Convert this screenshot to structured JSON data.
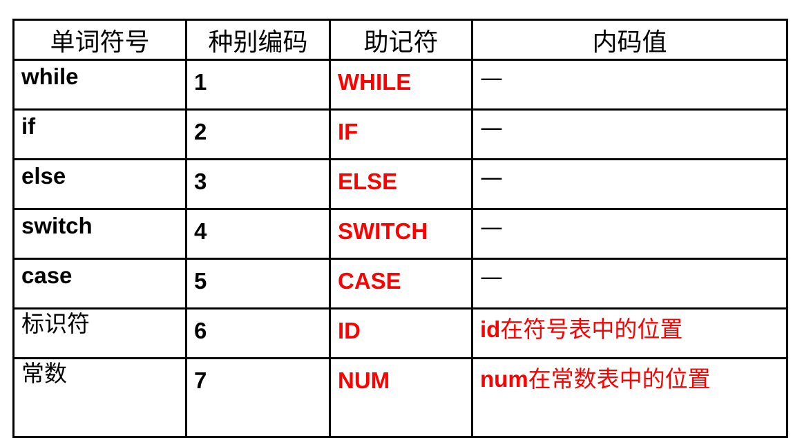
{
  "table": {
    "headers": [
      "单词符号",
      "种别编码",
      "助记符",
      "内码值"
    ],
    "rows": [
      {
        "word": "while",
        "code": "1",
        "mnemonic": "WHILE",
        "value": "—"
      },
      {
        "word": "if",
        "code": "2",
        "mnemonic": "IF",
        "value": "—"
      },
      {
        "word": "else",
        "code": "3",
        "mnemonic": "ELSE",
        "value": "—"
      },
      {
        "word": "switch",
        "code": "4",
        "mnemonic": "SWITCH",
        "value": "—"
      },
      {
        "word": "case",
        "code": "5",
        "mnemonic": "CASE",
        "value": "—"
      },
      {
        "word": "标识符",
        "code": "6",
        "mnemonic": "ID",
        "value_prefix": "id",
        "value_rest": "在符号表中的位置"
      },
      {
        "word": "常数",
        "code": "7",
        "mnemonic": "NUM",
        "value_prefix": "num",
        "value_rest": "在常数表中的位置"
      }
    ]
  },
  "colors": {
    "border": "#000000",
    "mnemonic": "#ff0000",
    "text": "#000000"
  }
}
